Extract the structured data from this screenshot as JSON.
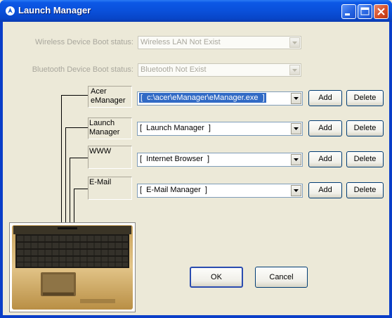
{
  "window": {
    "title": "Launch Manager",
    "controls": [
      "minimize",
      "maximize",
      "close"
    ]
  },
  "wireless": {
    "label": "Wireless Device Boot status:",
    "value": "Wireless LAN Not Exist"
  },
  "bluetooth": {
    "label": "Bluetooth Device Boot status:",
    "value": "Bluetooth Not Exist"
  },
  "keys": [
    {
      "label_line1": "Acer",
      "label_line2": "eManager",
      "value": "[  c:\\acer\\eManager\\eManager.exe  ]",
      "selected": true,
      "add": "Add",
      "delete": "Delete"
    },
    {
      "label_line1": "Launch",
      "label_line2": "Manager",
      "value": "[  Launch Manager  ]",
      "selected": false,
      "add": "Add",
      "delete": "Delete"
    },
    {
      "label_line1": "WWW",
      "label_line2": "",
      "value": "[  Internet Browser  ]",
      "selected": false,
      "add": "Add",
      "delete": "Delete"
    },
    {
      "label_line1": "E-Mail",
      "label_line2": "",
      "value": "[  E-Mail Manager  ]",
      "selected": false,
      "add": "Add",
      "delete": "Delete"
    }
  ],
  "footer": {
    "ok": "OK",
    "cancel": "Cancel"
  },
  "icons": {
    "title": "launch-manager-icon",
    "laptop": "laptop-keyboard-image"
  }
}
